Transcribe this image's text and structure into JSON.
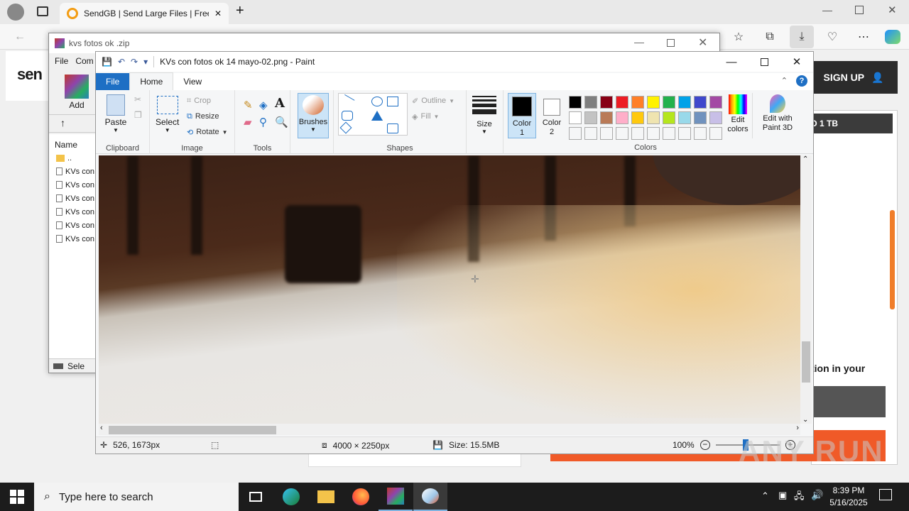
{
  "browser": {
    "tab_title": "SendGB | Send Large Files | Free f",
    "signup_label": "SIGN UP",
    "logo_text": "sen",
    "panel_label": "D 1 TB",
    "panel_text": "tion in your"
  },
  "winrar": {
    "title": "kvs fotos ok .zip",
    "menu": [
      "File",
      "Com"
    ],
    "add_label": "Add",
    "name_header": "Name",
    "rows": [
      "..",
      "KVs con",
      "KVs con",
      "KVs con",
      "KVs con",
      "KVs con",
      "KVs con"
    ],
    "status": "Sele"
  },
  "paint": {
    "title": "KVs con fotos ok 14 mayo-02.png - Paint",
    "tabs": [
      "File",
      "Home",
      "View"
    ],
    "clipboard": {
      "paste": "Paste",
      "label": "Clipboard"
    },
    "image": {
      "select": "Select",
      "crop": "Crop",
      "resize": "Resize",
      "rotate": "Rotate",
      "label": "Image"
    },
    "tools_label": "Tools",
    "brushes": "Brushes",
    "shapes": {
      "outline": "Outline",
      "fill": "Fill",
      "label": "Shapes"
    },
    "size": "Size",
    "color1": "Color 1",
    "color2": "Color 2",
    "colors_label": "Colors",
    "edit_colors": "Edit colors",
    "edit_paint3d": "Edit with Paint 3D",
    "palette": [
      "#000000",
      "#7f7f7f",
      "#880015",
      "#ed1c24",
      "#ff7f27",
      "#fff200",
      "#22b14c",
      "#00a2e8",
      "#3f48cc",
      "#a349a4",
      "#ffffff",
      "#c3c3c3",
      "#b97a57",
      "#ffaec9",
      "#ffc90e",
      "#efe4b0",
      "#b5e61d",
      "#99d9ea",
      "#7092be",
      "#c8bfe7"
    ],
    "status": {
      "cursor": "526, 1673px",
      "dimensions": "4000 × 2250px",
      "size": "Size: 15.5MB",
      "zoom": "100%"
    }
  },
  "taskbar": {
    "search_placeholder": "Type here to search",
    "time": "8:39 PM",
    "date": "5/16/2025"
  },
  "watermark": "ANY RUN"
}
